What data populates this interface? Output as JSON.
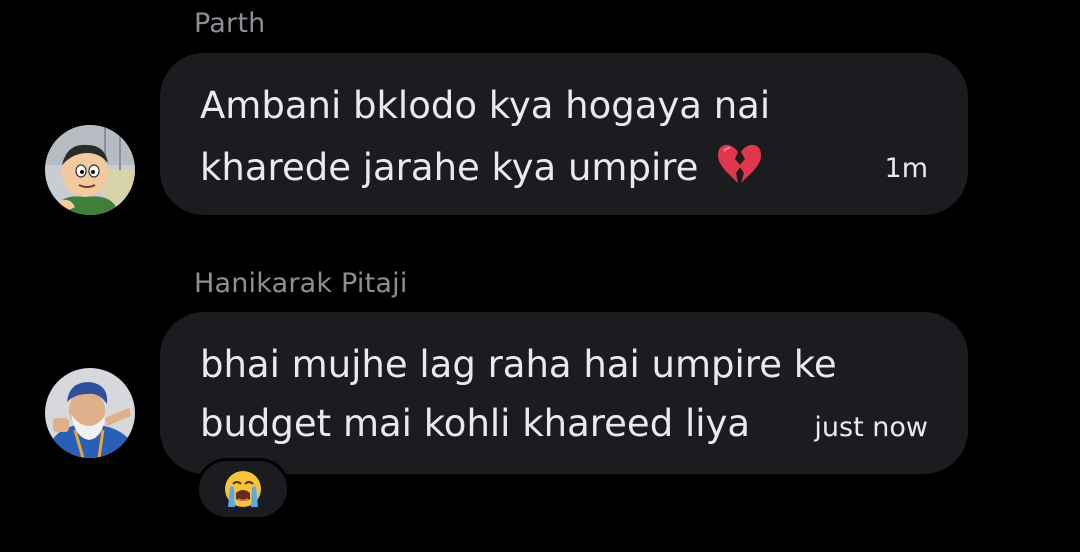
{
  "messages": [
    {
      "sender": "Parth",
      "lines": [
        "Ambani bklodo kya hogaya nai",
        "kharede jarahe kya umpire"
      ],
      "time": "1m",
      "emoji": "broken-heart-emoji"
    },
    {
      "sender": "Hanikarak Pitaji",
      "lines": [
        "bhai mujhe lag raha hai umpire ke",
        "budget mai kohli khareed liya"
      ],
      "time": "just now",
      "reaction": "crying-face-emoji"
    }
  ],
  "colors": {
    "background": "#000000",
    "bubble": "#1b1c20",
    "sender_name": "#8b8f96",
    "message_text": "#e9eaec"
  }
}
